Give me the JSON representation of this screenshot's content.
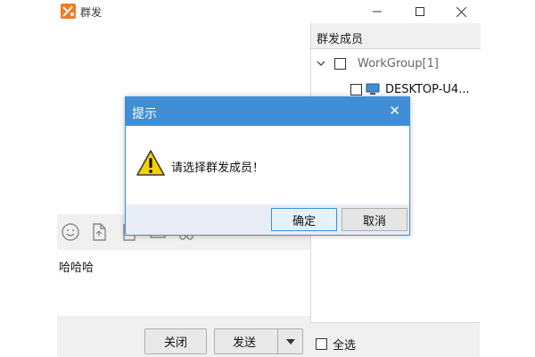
{
  "window": {
    "title": "群发",
    "logo_icon": "app-logo-icon",
    "controls": [
      "minimize-icon",
      "maximize-icon",
      "close-icon"
    ]
  },
  "toolbar": {
    "icons": [
      "emoji-icon",
      "file-icon",
      "screenshot-icon",
      "image-icon",
      "scissors-icon"
    ]
  },
  "input": {
    "value": "哈哈哈"
  },
  "members": {
    "header": "群发成员",
    "group": {
      "label": "WorkGroup[1]",
      "expanded": true,
      "checked": false
    },
    "device": {
      "label": "DESKTOP-U4...",
      "checked": false
    }
  },
  "bottom": {
    "close_label": "关闭",
    "send_label": "发送",
    "select_all_label": "全选"
  },
  "dialog": {
    "title": "提示",
    "message": "请选择群发成员！",
    "ok_label": "确定",
    "cancel_label": "取消"
  },
  "colors": {
    "accent": "#3f8ed6",
    "logo": "#f07a22",
    "warning": "#f5d300"
  }
}
